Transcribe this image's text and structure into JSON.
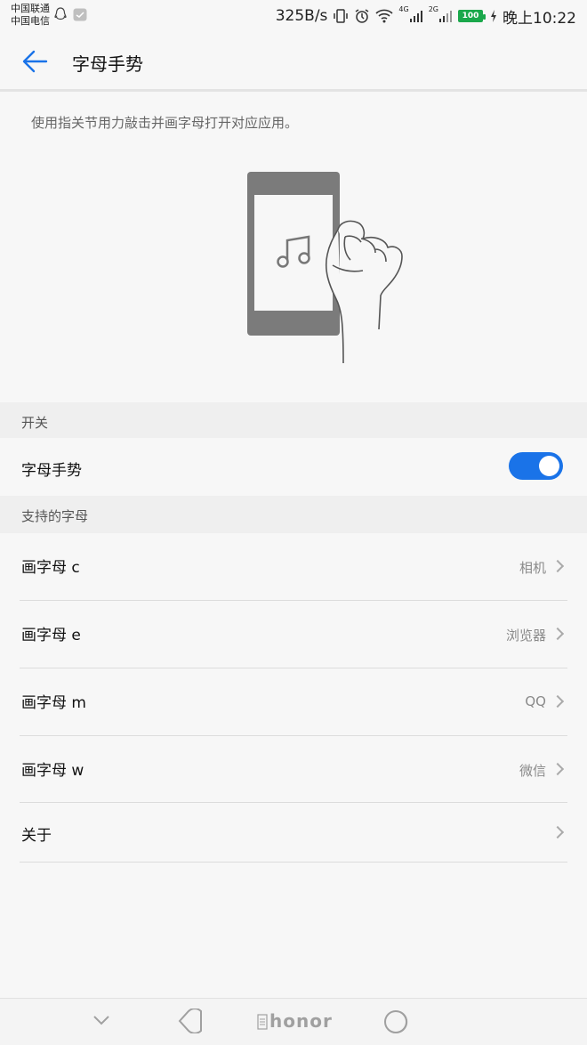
{
  "status_bar": {
    "carrier_1": "中国联通",
    "carrier_2": "中国电信",
    "speed": "325B/s",
    "net_1": "4G",
    "net_2": "2G",
    "battery": "100",
    "time": "晚上10:22"
  },
  "header": {
    "title": "字母手势"
  },
  "description": "使用指关节用力敲击并画字母打开对应应用。",
  "sections": {
    "switch": {
      "label": "开关",
      "toggle_title": "字母手势",
      "toggle_on": true
    },
    "letters": {
      "label": "支持的字母",
      "items": [
        {
          "title": "画字母 c",
          "value": "相机"
        },
        {
          "title": "画字母 e",
          "value": "浏览器"
        },
        {
          "title": "画字母 m",
          "value": "QQ"
        },
        {
          "title": "画字母 w",
          "value": "微信"
        },
        {
          "title": "关于",
          "value": ""
        }
      ]
    }
  },
  "navbar": {
    "brand": "honor"
  },
  "colors": {
    "accent": "#1a73e8",
    "background": "#f7f7f7",
    "section_bg": "#efefef",
    "battery": "#1aa84b"
  }
}
